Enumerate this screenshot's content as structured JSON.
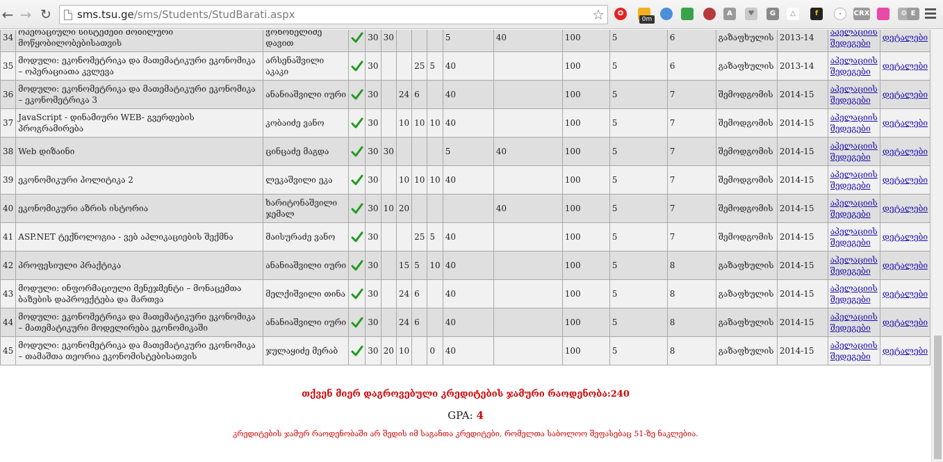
{
  "browser": {
    "url_host": "sms.tsu.ge",
    "url_path": "/sms/Students/StudBarati.aspx",
    "extension_badge": "0m",
    "extension_labels": [
      "CRX",
      "E",
      "G"
    ]
  },
  "rows": [
    {
      "num": "34",
      "subject": "ოპერაციული სისტემები მობილური მოწყობილობებისათვის",
      "lecturer": "ჭოხონელიძე დავით",
      "s1": "30",
      "s2": "30",
      "s3": "",
      "s4": "",
      "s5": "",
      "midterm": "5",
      "final": "40",
      "total": "100",
      "credits": "5",
      "semester": "6",
      "session": "გაზაფხულის",
      "year": "2013-14",
      "link1": "აპელაციის შედეგები",
      "link2": "დეტალები"
    },
    {
      "num": "35",
      "subject": "მოდული: ეკონომეტრიკა და მათემატიკური ეკონომიკა – ოპერაციათა კვლევა",
      "lecturer": "არსენაშვილი აკაკი",
      "s1": "30",
      "s2": "",
      "s3": "",
      "s4": "25",
      "s5": "5",
      "midterm": "40",
      "final": "",
      "total": "100",
      "credits": "5",
      "semester": "6",
      "session": "გაზაფხულის",
      "year": "2013-14",
      "link1": "აპელაციის შედეგები",
      "link2": "დეტალები"
    },
    {
      "num": "36",
      "subject": "მოდული: ეკონომეტრიკა და მათემატიკური ეკონომიკა – ეკონომეტრიკა 3",
      "lecturer": "ანანიაშვილი იური",
      "s1": "30",
      "s2": "",
      "s3": "24",
      "s4": "6",
      "s5": "",
      "midterm": "40",
      "final": "",
      "total": "100",
      "credits": "5",
      "semester": "7",
      "session": "შემოდგომის",
      "year": "2014-15",
      "link1": "აპელაციის შედეგები",
      "link2": "დეტალები"
    },
    {
      "num": "37",
      "subject": "JavaScript - დინამიური WEB- გვერდების პროგრამირება",
      "lecturer": "კობაიძე ვანო",
      "s1": "30",
      "s2": "",
      "s3": "10",
      "s4": "10",
      "s5": "10",
      "midterm": "40",
      "final": "",
      "total": "100",
      "credits": "5",
      "semester": "7",
      "session": "შემოდგომის",
      "year": "2014-15",
      "link1": "აპელაციის შედეგები",
      "link2": "დეტალები"
    },
    {
      "num": "38",
      "subject": "Web დიზაინი",
      "lecturer": "ცინცაძე მაგდა",
      "s1": "30",
      "s2": "30",
      "s3": "",
      "s4": "",
      "s5": "",
      "midterm": "5",
      "final": "40",
      "total": "100",
      "credits": "5",
      "semester": "7",
      "session": "შემოდგომის",
      "year": "2014-15",
      "link1": "აპელაციის შედეგები",
      "link2": "დეტალები"
    },
    {
      "num": "39",
      "subject": "ეკონომიკური პოლიტიკა 2",
      "lecturer": "ლეკაშვილი ეკა",
      "s1": "30",
      "s2": "",
      "s3": "10",
      "s4": "10",
      "s5": "10",
      "midterm": "40",
      "final": "",
      "total": "100",
      "credits": "5",
      "semester": "7",
      "session": "შემოდგომის",
      "year": "2014-15",
      "link1": "აპელაციის შედეგები",
      "link2": "დეტალები"
    },
    {
      "num": "40",
      "subject": "ეკონომიკური აზრის ისტორია",
      "lecturer": "ხარიტონაშვილი ჯემალ",
      "s1": "30",
      "s2": "10",
      "s3": "20",
      "s4": "",
      "s5": "",
      "midterm": "",
      "final": "40",
      "total": "100",
      "credits": "5",
      "semester": "7",
      "session": "შემოდგომის",
      "year": "2014-15",
      "link1": "აპელაციის შედეგები",
      "link2": "დეტალები"
    },
    {
      "num": "41",
      "subject": "ASP.NET ტექნოლოგია - ვებ აპლიკაციების შექმნა",
      "lecturer": "მაისურაძე ვანო",
      "s1": "30",
      "s2": "",
      "s3": "",
      "s4": "25",
      "s5": "5",
      "midterm": "40",
      "final": "",
      "total": "100",
      "credits": "5",
      "semester": "7",
      "session": "შემოდგომის",
      "year": "2014-15",
      "link1": "აპელაციის შედეგები",
      "link2": "დეტალები"
    },
    {
      "num": "42",
      "subject": "პროფესიული პრაქტიკა",
      "lecturer": "ანანიაშვილი იური",
      "s1": "30",
      "s2": "",
      "s3": "15",
      "s4": "5",
      "s5": "10",
      "midterm": "40",
      "final": "",
      "total": "100",
      "credits": "5",
      "semester": "8",
      "session": "გაზაფხულის",
      "year": "2014-15",
      "link1": "აპელაციის შედეგები",
      "link2": "დეტალები"
    },
    {
      "num": "43",
      "subject": "მოდული: ინფორმაციული მენეჯმენტი – მონაცემთა ბაზების დაპროექტება და მართვა",
      "lecturer": "მელქიშვილი თინა",
      "s1": "30",
      "s2": "",
      "s3": "24",
      "s4": "6",
      "s5": "",
      "midterm": "40",
      "final": "",
      "total": "100",
      "credits": "5",
      "semester": "8",
      "session": "გაზაფხულის",
      "year": "2014-15",
      "link1": "აპელაციის შედეგები",
      "link2": "დეტალები"
    },
    {
      "num": "44",
      "subject": "მოდული: ეკონომეტრიკა და მათემატიკური ეკონომიკა – მათემატიკური მოდელირება ეკონომიკაში",
      "lecturer": "ანანიაშვილი იური",
      "s1": "30",
      "s2": "",
      "s3": "24",
      "s4": "6",
      "s5": "",
      "midterm": "40",
      "final": "",
      "total": "100",
      "credits": "5",
      "semester": "8",
      "session": "გაზაფხულის",
      "year": "2014-15",
      "link1": "აპელაციის შედეგები",
      "link2": "დეტალები"
    },
    {
      "num": "45",
      "subject": "მოდული: ეკონომეტრიკა და მათემატიკური ეკონომიკა – თამაშთა თეორია ეკონომისტებისათვის",
      "lecturer": "ჯულაყიძე მერაბ",
      "s1": "30",
      "s2": "20",
      "s3": "10",
      "s4": "",
      "s5": "0",
      "midterm": "40",
      "final": "",
      "total": "100",
      "credits": "5",
      "semester": "8",
      "session": "გაზაფხულის",
      "year": "2014-15",
      "link1": "აპელაციის შედეგები",
      "link2": "დეტალები"
    }
  ],
  "summary": {
    "credits_label": "თქვენ მიერ დაგროვებული კრედიტების ჯამური რაოდენობა:240",
    "gpa_label": "GPA:",
    "gpa_value": "4",
    "note": "კრედიტების ჯამურ რაოდენობაში არ შედის იმ საგანთა კრედიტები, რომელთა საბოლოო შეფასებაც 51-ზე ნაკლებია."
  },
  "colors": {
    "link": "#1a0dab",
    "accent_red": "#d40000",
    "check_green": "#1f9a1f",
    "row_light": "#f1f1f1",
    "row_dark": "#dfdfdf"
  }
}
